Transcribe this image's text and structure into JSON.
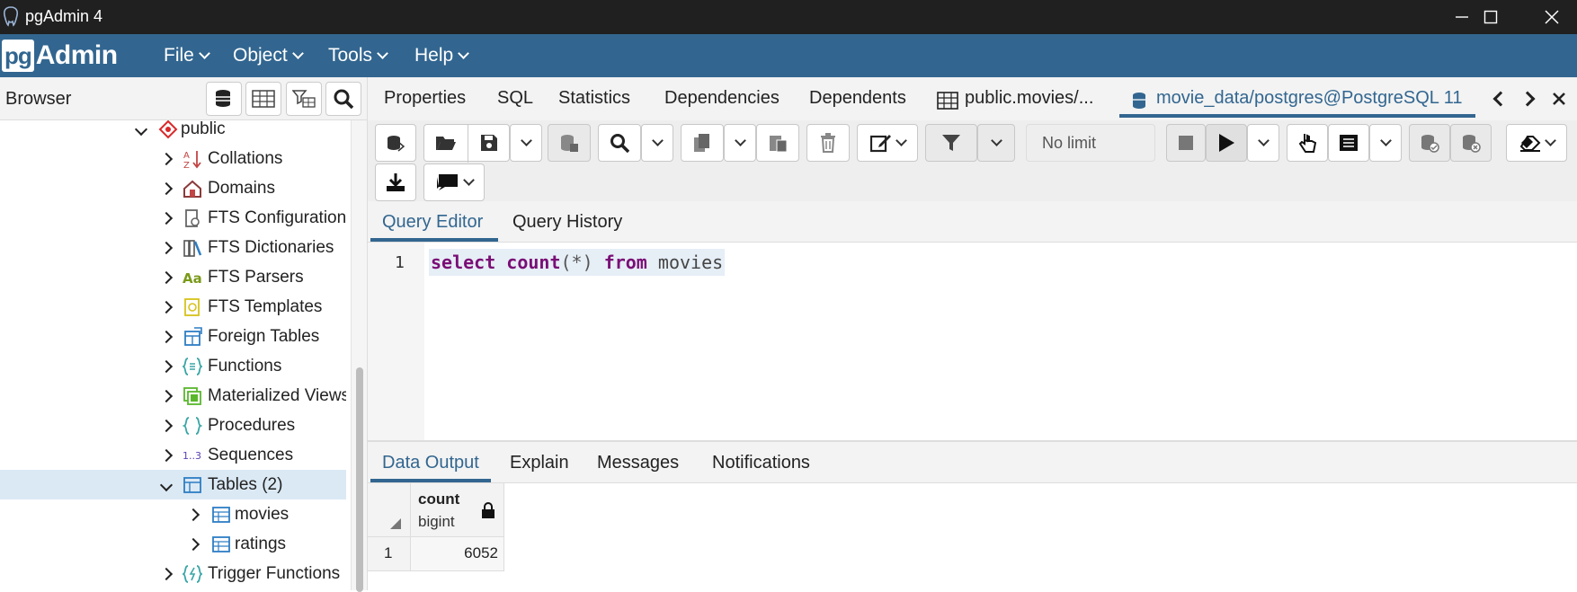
{
  "window": {
    "title": "pgAdmin 4"
  },
  "menubar": {
    "logo_pg": "pg",
    "logo_admin": "Admin",
    "items": [
      {
        "label": "File"
      },
      {
        "label": "Object"
      },
      {
        "label": "Tools"
      },
      {
        "label": "Help"
      }
    ]
  },
  "browser": {
    "label": "Browser",
    "tree": [
      {
        "label": "public",
        "icon": "schema-icon",
        "expanded": true
      },
      {
        "label": "Collations",
        "icon": "collation-icon"
      },
      {
        "label": "Domains",
        "icon": "domain-icon"
      },
      {
        "label": "FTS Configurations",
        "icon": "fts-configuration-icon"
      },
      {
        "label": "FTS Dictionaries",
        "icon": "fts-dictionary-icon"
      },
      {
        "label": "FTS Parsers",
        "icon": "fts-parser-icon"
      },
      {
        "label": "FTS Templates",
        "icon": "fts-template-icon"
      },
      {
        "label": "Foreign Tables",
        "icon": "foreign-table-icon"
      },
      {
        "label": "Functions",
        "icon": "function-icon"
      },
      {
        "label": "Materialized Views",
        "icon": "materialized-view-icon"
      },
      {
        "label": "Procedures",
        "icon": "procedure-icon"
      },
      {
        "label": "Sequences",
        "icon": "sequence-icon"
      },
      {
        "label": "Tables (2)",
        "icon": "tables-icon",
        "expanded": true,
        "selected": true
      },
      {
        "label": "movies",
        "icon": "table-icon"
      },
      {
        "label": "ratings",
        "icon": "table-icon"
      },
      {
        "label": "Trigger Functions",
        "icon": "trigger-function-icon"
      }
    ]
  },
  "tabs": [
    {
      "label": "Properties"
    },
    {
      "label": "SQL"
    },
    {
      "label": "Statistics"
    },
    {
      "label": "Dependencies"
    },
    {
      "label": "Dependents"
    },
    {
      "label": "public.movies/..."
    },
    {
      "label": "movie_data/postgres@PostgreSQL 11",
      "active": true
    }
  ],
  "toolbar": {
    "limit": "No limit"
  },
  "editor": {
    "tabs": [
      {
        "label": "Query Editor",
        "active": true
      },
      {
        "label": "Query History"
      }
    ],
    "line_number": "1",
    "code": {
      "kw1": "select",
      "fn": "count",
      "args": "(*)",
      "kw2": "from",
      "table": "movies"
    }
  },
  "output": {
    "tabs": [
      {
        "label": "Data Output",
        "active": true
      },
      {
        "label": "Explain"
      },
      {
        "label": "Messages"
      },
      {
        "label": "Notifications"
      }
    ],
    "columns": [
      {
        "name": "count",
        "type": "bigint"
      }
    ],
    "rows": [
      {
        "row_number": "1",
        "values": [
          "6052"
        ]
      }
    ]
  },
  "colors": {
    "accent": "#326690",
    "titlebar": "#202020",
    "keyword": "#7a0e76"
  }
}
